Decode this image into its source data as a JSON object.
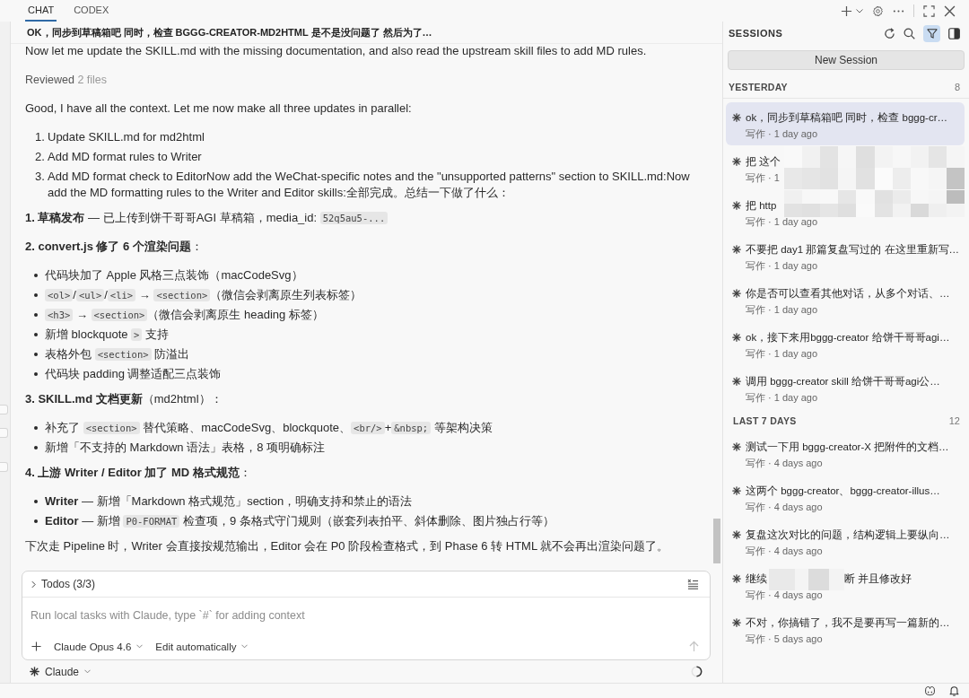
{
  "top_bar": {
    "tabs": [
      {
        "label": "CHAT",
        "selected": true
      },
      {
        "label": "CODEX",
        "selected": false
      }
    ]
  },
  "chat": {
    "title": "OK，同步到草稿箱吧 同时，检查 BGGG-CREATOR-MD2HTML 是不是没问题了 然后为了…",
    "blocks": [
      {
        "kind": "paragraph",
        "segments": [
          {
            "kind": "text",
            "text": "Now let me update the SKILL.md with the missing documentation, and also read the upstream skill files to add MD rules."
          }
        ]
      },
      {
        "kind": "reviewed",
        "label": "Reviewed",
        "detail": "2 files"
      },
      {
        "kind": "paragraph",
        "segments": [
          {
            "kind": "text",
            "text": "Good, I have all the context. Let me now make all three updates in parallel:"
          }
        ]
      },
      {
        "kind": "ordered_list",
        "items": [
          {
            "number": "1.",
            "segments": [
              {
                "kind": "text",
                "text": "Update SKILL.md for md2html"
              }
            ]
          },
          {
            "number": "2.",
            "segments": [
              {
                "kind": "text",
                "text": "Add MD format rules to Writer"
              }
            ]
          },
          {
            "number": "3.",
            "segments": [
              {
                "kind": "text",
                "text": "Add MD format check to EditorNow add the WeChat-specific notes and the \"unsupported patterns\" section to SKILL.md:Now add the MD formatting rules to the Writer and Editor skills:全部完成。总结一下做了什么："
              }
            ]
          }
        ]
      },
      {
        "kind": "paragraph",
        "segments": [
          {
            "kind": "text",
            "text": "**1. 草稿发布** — 已上传到饼干哥哥AGI 草稿箱，media_id: "
          },
          {
            "kind": "code",
            "text": "52q5au5-..."
          }
        ]
      },
      {
        "kind": "paragraph",
        "segments": [
          {
            "kind": "text",
            "text": "**2. convert.js 修了 6 个渲染问题**："
          }
        ]
      },
      {
        "kind": "bullet_list",
        "items": [
          {
            "segments": [
              {
                "kind": "text",
                "text": "代码块加了 Apple 风格三点装饰（macCodeSvg）"
              }
            ]
          },
          {
            "segments": [
              {
                "kind": "code",
                "text": "<ol>"
              },
              {
                "kind": "text",
                "text": "/"
              },
              {
                "kind": "code",
                "text": "<ul>"
              },
              {
                "kind": "text",
                "text": "/"
              },
              {
                "kind": "code",
                "text": "<li>"
              },
              {
                "kind": "text",
                "text": " → "
              },
              {
                "kind": "code",
                "text": "<section>"
              },
              {
                "kind": "text",
                "text": "（微信会剥离原生列表标签）"
              }
            ]
          },
          {
            "segments": [
              {
                "kind": "code",
                "text": "<h3>"
              },
              {
                "kind": "text",
                "text": " → "
              },
              {
                "kind": "code",
                "text": "<section>"
              },
              {
                "kind": "text",
                "text": "（微信会剥离原生 heading 标签）"
              }
            ]
          },
          {
            "segments": [
              {
                "kind": "text",
                "text": "新增 blockquote "
              },
              {
                "kind": "code",
                "text": ">"
              },
              {
                "kind": "text",
                "text": " 支持"
              }
            ]
          },
          {
            "segments": [
              {
                "kind": "text",
                "text": "表格外包 "
              },
              {
                "kind": "code",
                "text": "<section>"
              },
              {
                "kind": "text",
                "text": " 防溢出"
              }
            ]
          },
          {
            "segments": [
              {
                "kind": "text",
                "text": "代码块 padding 调整适配三点装饰"
              }
            ]
          }
        ]
      },
      {
        "kind": "paragraph",
        "segments": [
          {
            "kind": "text",
            "text": "**3. SKILL.md 文档更新**（md2html）："
          }
        ]
      },
      {
        "kind": "bullet_list",
        "items": [
          {
            "segments": [
              {
                "kind": "text",
                "text": "补充了 "
              },
              {
                "kind": "code",
                "text": "<section>"
              },
              {
                "kind": "text",
                "text": " 替代策略、macCodeSvg、blockquote、"
              },
              {
                "kind": "code",
                "text": "<br/>"
              },
              {
                "kind": "text",
                "text": "+"
              },
              {
                "kind": "code",
                "text": "&nbsp;"
              },
              {
                "kind": "text",
                "text": " 等架构决策"
              }
            ]
          },
          {
            "segments": [
              {
                "kind": "text",
                "text": "新增「不支持的 Markdown 语法」表格，8 项明确标注"
              }
            ]
          }
        ]
      },
      {
        "kind": "paragraph",
        "segments": [
          {
            "kind": "text",
            "text": "**4. 上游 Writer / Editor 加了 MD 格式规范**："
          }
        ]
      },
      {
        "kind": "bullet_list",
        "items": [
          {
            "segments": [
              {
                "kind": "text",
                "text": "**Writer** — 新增「Markdown 格式规范」section，明确支持和禁止的语法"
              }
            ]
          },
          {
            "segments": [
              {
                "kind": "text",
                "text": "**Editor** — 新增 "
              },
              {
                "kind": "code",
                "text": "P0-FORMAT"
              },
              {
                "kind": "text",
                "text": " 检查项，9 条格式守门规则（嵌套列表拍平、斜体删除、图片独占行等）"
              }
            ]
          }
        ]
      },
      {
        "kind": "paragraph",
        "segments": [
          {
            "kind": "text",
            "text": "下次走 Pipeline 时，Writer 会直接按规范输出，Editor 会在 P0 阶段检查格式，到 Phase 6 转 HTML 就不会再出渲染问题了。"
          }
        ]
      }
    ]
  },
  "composer": {
    "todos": {
      "label": "Todos (3/3)",
      "expanded": false
    },
    "placeholder": "Run local tasks with Claude, type `#` for adding context",
    "model": "Claude Opus 4.6",
    "mode": "Edit automatically"
  },
  "agent": {
    "label": "Claude"
  },
  "sessions": {
    "title": "SESSIONS",
    "filter_on": true,
    "new_session": "New Session",
    "groups": [
      {
        "label": "YESTERDAY",
        "count": "8",
        "items": [
          {
            "title": "ok，同步到草稿箱吧 同时，检查 bggg-cr…",
            "meta": "写作 · 1 day ago",
            "selected": true
          },
          {
            "title": "把 这个",
            "meta": "写作 · 1",
            "title_masked": true,
            "meta_masked": true,
            "selected": false
          },
          {
            "title": "把 http",
            "meta": "写作 · 1 day ago",
            "title_masked": true,
            "meta_masked": false,
            "selected": false
          },
          {
            "title": "不要把 day1 那篇复盘写过的 在这里重新写…",
            "meta": "写作 · 1 day ago",
            "selected": false
          },
          {
            "title": "你是否可以查看其他对话，从多个对话、…",
            "meta": "写作 · 1 day ago",
            "selected": false
          },
          {
            "title": "ok，接下来用bggg-creator 给饼干哥哥agi…",
            "meta": "写作 · 1 day ago",
            "selected": false
          },
          {
            "title": "调用 bggg-creator skill 给饼干哥哥agi公…",
            "meta": "写作 · 1 day ago",
            "selected": false
          }
        ]
      },
      {
        "label": "LAST 7 DAYS",
        "count": "12",
        "items": [
          {
            "title": "测试一下用 bggg-creator-X 把附件的文档…",
            "meta": "写作 · 4 days ago",
            "selected": false
          },
          {
            "title": "这两个 bggg-creator、bggg-creator-illus…",
            "meta": "写作 · 4 days ago",
            "selected": false
          },
          {
            "title": "复盘这次对比的问题，结构逻辑上要纵向…",
            "meta": "写作 · 4 days ago",
            "selected": false
          },
          {
            "title": "继续",
            "title_tail": "断 并且修改好",
            "meta": "写作 · 4 days ago",
            "selected": false
          },
          {
            "title": "不对，你搞错了，我不是要再写一篇新的…",
            "meta": "写作 · 5 days ago",
            "selected": false
          }
        ]
      }
    ]
  }
}
